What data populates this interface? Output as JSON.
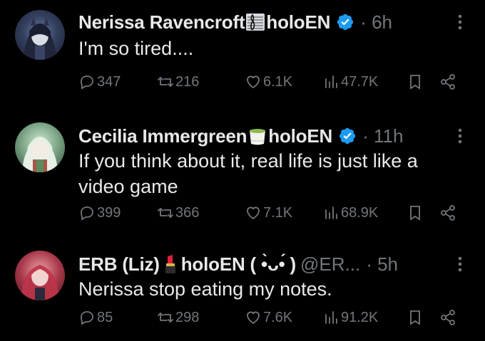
{
  "tweets": [
    {
      "name_a": "Nerissa Ravencroft",
      "name_b": "holoEN",
      "handle": "",
      "emoji": "musical-score-icon",
      "time": "· 6h",
      "text": "I'm so tired....",
      "stats": {
        "replies": "347",
        "retweets": "216",
        "likes": "6.1K",
        "views": "47.7K"
      }
    },
    {
      "name_a": "Cecilia Immergreen",
      "name_b": "holoEN",
      "handle": "",
      "emoji": "tea-cup-icon",
      "time": "· 11h",
      "text": "If you think about it, real life is just like a video game",
      "stats": {
        "replies": "399",
        "retweets": "366",
        "likes": "7.1K",
        "views": "68.9K"
      }
    },
    {
      "name_a": "ERB (Liz)",
      "name_b": "holoEN ( •̀ᴗ•́ )",
      "handle": "@ER...",
      "emoji": "lipstick-icon",
      "time": "· 5h",
      "text": "Nerissa stop eating my notes.",
      "stats": {
        "replies": "85",
        "retweets": "298",
        "likes": "7.6K",
        "views": "91.2K"
      }
    }
  ],
  "colors": {
    "background": "#000000",
    "text": "#e7e9ea",
    "muted": "#71767b",
    "verified": "#1d9bf0"
  }
}
